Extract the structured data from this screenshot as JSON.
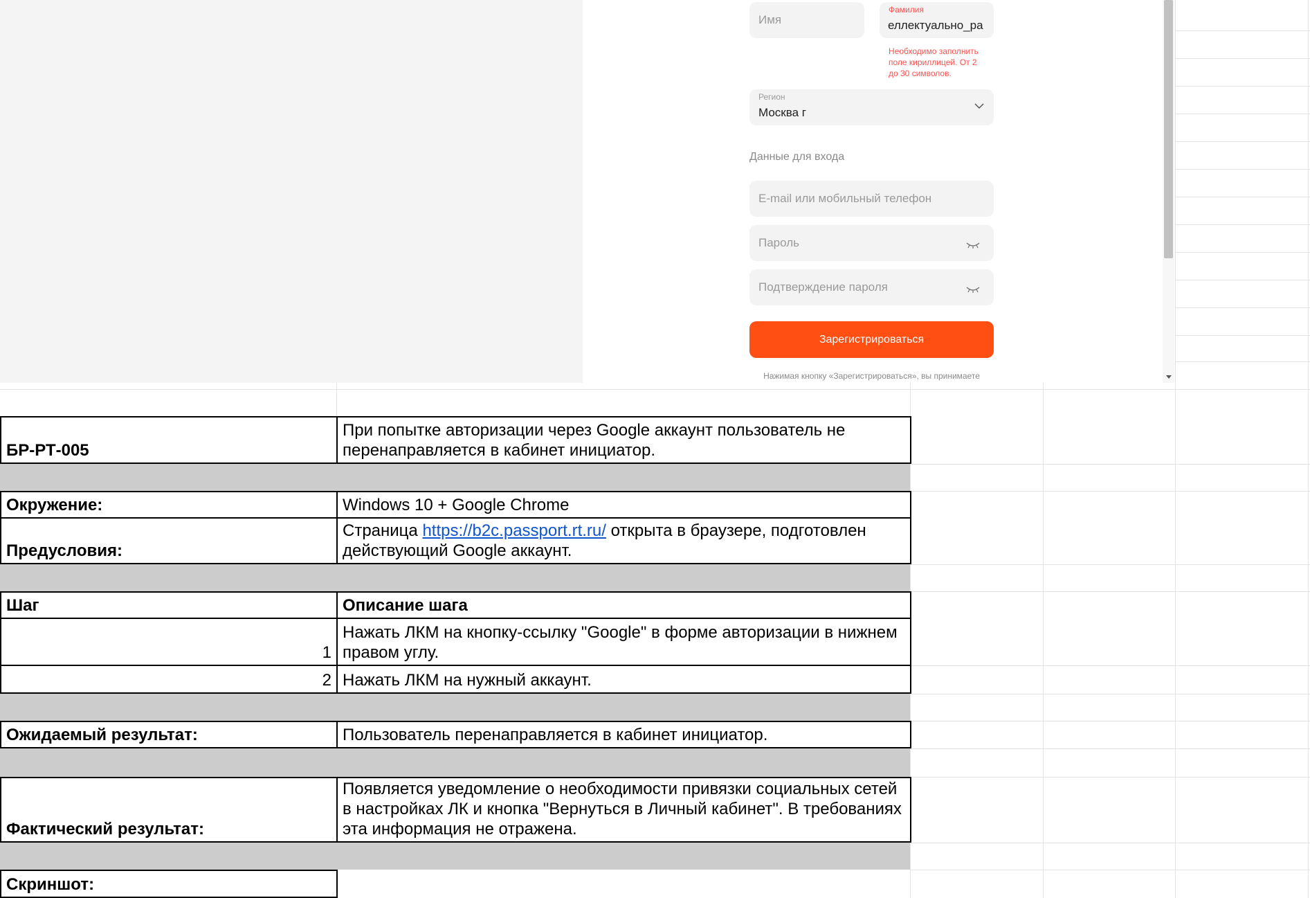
{
  "form": {
    "first_name_placeholder": "Имя",
    "last_name_label": "Фамилия",
    "last_name_value": "еллектуально_ра",
    "last_name_error": [
      "Необходимо заполнить",
      "поле кириллицей. От 2",
      "до 30 символов."
    ],
    "region_label": "Регион",
    "region_value": "Москва г",
    "login_section_title": "Данные для входа",
    "email_placeholder": "E-mail или мобильный телефон",
    "password_placeholder": "Пароль",
    "confirm_password_placeholder": "Подтверждение пароля",
    "register_button": "Зарегистрироваться",
    "terms_text": "Нажимая кнопку «Зарегистрироваться», вы принимаете"
  },
  "bug": {
    "id": "БР-РТ-005",
    "summary": "При попытке авторизации через Google аккаунт пользователь не перенаправляется в кабинет инициатор.",
    "environment_label": "Окружение:",
    "environment_value": "Windows 10 + Google Chrome",
    "preconditions_label": "Предусловия:",
    "preconditions_before": "Страница ",
    "preconditions_link": "https://b2c.passport.rt.ru/",
    "preconditions_after": " открыта в браузере, подготовлен действующий Google аккаунт.",
    "step_header": "Шаг",
    "step_desc_header": "Описание шага",
    "steps": [
      {
        "num": "1",
        "text": "Нажать ЛКМ на кнопку-ссылку \"Google\" в форме авторизации в нижнем правом углу."
      },
      {
        "num": "2",
        "text": "Нажать ЛКМ на нужный аккаунт."
      }
    ],
    "expected_label": "Ожидаемый результат:",
    "expected_value": "Пользователь перенаправляется в кабинет инициатор.",
    "actual_label": "Фактический результат:",
    "actual_value": "Появляется уведомление о необходимости привязки социальных сетей в настройках ЛК и кнопка \"Вернуться в Личный кабинет\". В требованиях эта информация не отражена.",
    "screenshot_label": "Скриншот:"
  }
}
